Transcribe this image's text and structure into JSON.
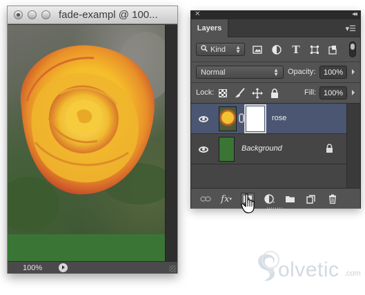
{
  "document": {
    "title": "fade-exampl @ 100...",
    "zoom": "100%"
  },
  "layers_panel": {
    "tab_label": "Layers",
    "filter": {
      "kind_label": "Kind"
    },
    "blend_mode": "Normal",
    "opacity_label": "Opacity:",
    "opacity_value": "100%",
    "lock_label": "Lock:",
    "fill_label": "Fill:",
    "fill_value": "100%",
    "layers": [
      {
        "name": "rose",
        "selected": true,
        "has_mask": true,
        "visible": true
      },
      {
        "name": "Background",
        "selected": false,
        "locked": true,
        "visible": true
      }
    ],
    "bottom_tools": [
      "link-layers-icon",
      "fx-icon",
      "add-layer-mask-icon",
      "adjustment-layer-icon",
      "new-group-icon",
      "new-layer-icon",
      "delete-layer-icon"
    ],
    "fx_label": "fx"
  },
  "colors": {
    "panel_bg": "#535353",
    "selected_layer": "#4a5672",
    "background_layer_fill": "#3a7535"
  },
  "watermark": {
    "text": "olvetic",
    "suffix": ".com"
  }
}
